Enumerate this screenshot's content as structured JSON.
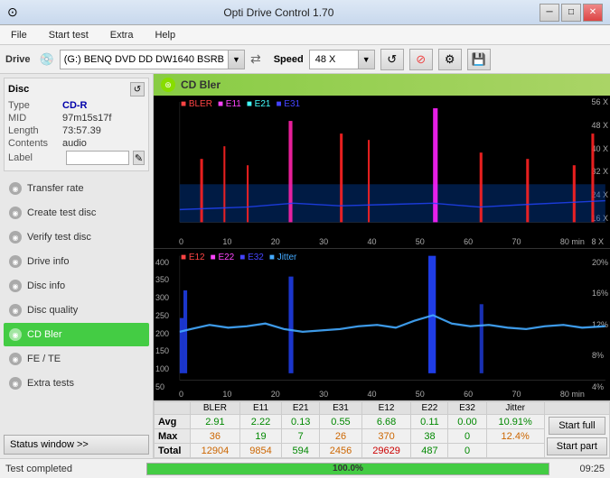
{
  "titleBar": {
    "title": "Opti Drive Control 1.70",
    "icon": "⊙",
    "minimize": "─",
    "restore": "□",
    "close": "✕"
  },
  "menuBar": {
    "items": [
      {
        "label": "File",
        "active": false
      },
      {
        "label": "Start test",
        "active": false
      },
      {
        "label": "Extra",
        "active": false
      },
      {
        "label": "Help",
        "active": false
      }
    ]
  },
  "driveBar": {
    "label": "Drive",
    "driveValue": "(G:)  BENQ DVD DD DW1640 BSRB",
    "speedLabel": "Speed",
    "speedValue": "48 X"
  },
  "disc": {
    "title": "Disc",
    "type": {
      "key": "Type",
      "value": "CD-R"
    },
    "mid": {
      "key": "MID",
      "value": "97m15s17f"
    },
    "length": {
      "key": "Length",
      "value": "73:57.39"
    },
    "contents": {
      "key": "Contents",
      "value": "audio"
    },
    "label": {
      "key": "Label",
      "value": ""
    }
  },
  "sidebar": {
    "items": [
      {
        "id": "transfer-rate",
        "label": "Transfer rate",
        "active": false
      },
      {
        "id": "create-test-disc",
        "label": "Create test disc",
        "active": false
      },
      {
        "id": "verify-test-disc",
        "label": "Verify test disc",
        "active": false
      },
      {
        "id": "drive-info",
        "label": "Drive info",
        "active": false
      },
      {
        "id": "disc-info",
        "label": "Disc info",
        "active": false
      },
      {
        "id": "disc-quality",
        "label": "Disc quality",
        "active": false
      },
      {
        "id": "cd-bler",
        "label": "CD Bler",
        "active": true
      },
      {
        "id": "fe-te",
        "label": "FE / TE",
        "active": false
      },
      {
        "id": "extra-tests",
        "label": "Extra tests",
        "active": false
      }
    ],
    "statusWindow": "Status window >>"
  },
  "chart": {
    "title": "CD Bler",
    "topLegend": [
      "BLER",
      "E11",
      "E21",
      "E31"
    ],
    "topLegendColors": [
      "#ff4444",
      "#ff44ff",
      "#44ffff",
      "#4444ff"
    ],
    "bottomLegend": [
      "E12",
      "E22",
      "E32",
      "Jitter"
    ],
    "bottomLegendColors": [
      "#ff4444",
      "#ff44ff",
      "#4444ff",
      "#44ccff"
    ],
    "topYMax": "56 X",
    "bottomYMax": "20%"
  },
  "stats": {
    "headers": [
      "BLER",
      "E11",
      "E21",
      "E31",
      "E12",
      "E22",
      "E32",
      "Jitter"
    ],
    "rows": [
      {
        "label": "Avg",
        "values": [
          "2.91",
          "2.22",
          "0.13",
          "0.55",
          "6.68",
          "0.11",
          "0.00",
          "10.91%"
        ],
        "colorClass": [
          "green",
          "green",
          "green",
          "green",
          "green",
          "green",
          "green",
          "green"
        ]
      },
      {
        "label": "Max",
        "values": [
          "36",
          "19",
          "7",
          "26",
          "370",
          "38",
          "0",
          "12.4%"
        ],
        "colorClass": [
          "orange",
          "green",
          "green",
          "orange",
          "orange",
          "green",
          "green",
          "orange"
        ]
      },
      {
        "label": "Total",
        "values": [
          "12904",
          "9854",
          "594",
          "2456",
          "29629",
          "487",
          "0",
          ""
        ],
        "colorClass": [
          "orange",
          "orange",
          "green",
          "orange",
          "red",
          "green",
          "green",
          "green"
        ]
      }
    ],
    "startFullBtn": "Start full",
    "startPartBtn": "Start part"
  },
  "statusBar": {
    "text": "Test completed",
    "progress": 100,
    "progressText": "100.0%",
    "time": "09:25"
  }
}
